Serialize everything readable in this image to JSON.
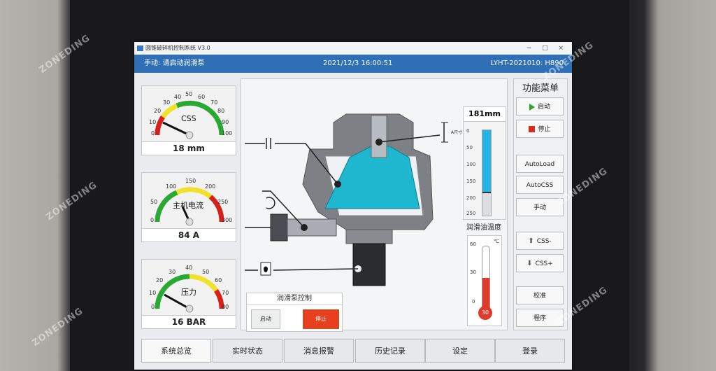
{
  "window": {
    "title": "圆锥破碎机控制系统 V3.0",
    "controls": "− □ ×"
  },
  "header": {
    "mode": "手动: 请启动润滑泵",
    "datetime": "2021/12/3 16:00:51",
    "machine": "LYHT-2021010:  H890"
  },
  "gauges": [
    {
      "name": "CSS",
      "value_text": "18 mm",
      "ticks": [
        "0",
        "10",
        "20",
        "30",
        "40",
        "50",
        "60",
        "70",
        "80",
        "90",
        "100"
      ],
      "value": 18,
      "max": 100
    },
    {
      "name": "主机电流",
      "value_text": "84 A",
      "ticks": [
        "0",
        "50",
        "100",
        "150",
        "200",
        "250",
        "300"
      ],
      "value": 84,
      "max": 300
    },
    {
      "name": "压力",
      "value_text": "16 BAR",
      "ticks": [
        "0",
        "10",
        "20",
        "30",
        "40",
        "50",
        "60",
        "70",
        "80"
      ],
      "value": 16,
      "max": 80
    }
  ],
  "diagram": {
    "ar_label": "A尺寸"
  },
  "pump": {
    "title": "润滑泵控制",
    "start": "启动",
    "stop": "停止"
  },
  "level": {
    "value_text": "181mm",
    "ticks": [
      "0",
      "50",
      "100",
      "150",
      "200",
      "250"
    ],
    "value": 181,
    "max": 250
  },
  "oil_temp": {
    "title": "润滑油温度",
    "unit": "℃",
    "ticks": [
      "60",
      "30",
      "0"
    ],
    "value_text": "30",
    "value": 30,
    "max": 60
  },
  "menu": {
    "title": "功能菜单",
    "start": "启动",
    "stop": "停止",
    "autoload": "AutoLoad",
    "autocss": "AutoCSS",
    "manual": "手动",
    "css_minus": "CSS-",
    "css_plus": "CSS+",
    "calibrate": "校准",
    "program": "程序"
  },
  "tabs": [
    "系统总览",
    "实时状态",
    "消息报警",
    "历史记录",
    "设定",
    "登录"
  ],
  "colors": {
    "header": "#2f6fb6",
    "cone": "#1fb6cf",
    "stop_red": "#e8401e",
    "level_blue": "#27b3e6",
    "temp_red": "#e03a2c"
  },
  "watermark": "ZONEDING"
}
